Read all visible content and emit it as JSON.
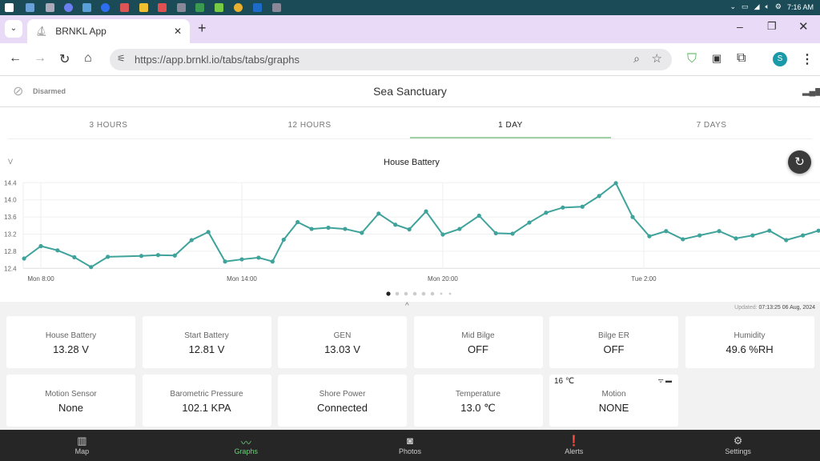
{
  "taskbar": {
    "time": "7:16 AM"
  },
  "browser": {
    "tab_title": "BRNKL App",
    "url": "https://app.brnkl.io/tabs/tabs/graphs",
    "profile_initial": "S"
  },
  "header": {
    "status": "Disarmed",
    "title": "Sea Sanctuary"
  },
  "ranges": [
    {
      "label": "3 HOURS",
      "active": false
    },
    {
      "label": "12 HOURS",
      "active": false
    },
    {
      "label": "1 DAY",
      "active": true
    },
    {
      "label": "7 DAYS",
      "active": false
    }
  ],
  "chart_data": {
    "type": "line",
    "title": "House Battery",
    "ylabel": "V",
    "ylim": [
      12.4,
      14.4
    ],
    "yticks": [
      "12.4",
      "12.8",
      "13.2",
      "13.6",
      "14.0",
      "14.4"
    ],
    "xticks": [
      "Mon 8:00",
      "Mon 14:00",
      "Mon 20:00",
      "Tue 2:00"
    ],
    "grid": true,
    "color": "#3fa39b",
    "x": [
      "Mon 7:30",
      "Mon 8:00",
      "Mon 8:30",
      "Mon 9:00",
      "Mon 9:30",
      "Mon 10:00",
      "Mon 11:00",
      "Mon 11:30",
      "Mon 12:00",
      "Mon 12:30",
      "Mon 13:00",
      "Mon 13:30",
      "Mon 14:00",
      "Mon 14:30",
      "Mon 14:55",
      "Mon 15:15",
      "Mon 15:40",
      "Mon 16:05",
      "Mon 16:35",
      "Mon 17:05",
      "Mon 17:35",
      "Mon 18:05",
      "Mon 18:35",
      "Mon 19:00",
      "Mon 19:30",
      "Mon 20:00",
      "Mon 20:30",
      "Mon 21:05",
      "Mon 21:35",
      "Mon 22:05",
      "Mon 22:35",
      "Mon 23:05",
      "Mon 23:35",
      "Tue 0:10",
      "Tue 0:40",
      "Tue 1:10",
      "Tue 1:40",
      "Tue 2:10",
      "Tue 2:40",
      "Tue 3:10",
      "Tue 3:40",
      "Tue 4:15",
      "Tue 4:45",
      "Tue 5:15",
      "Tue 5:45",
      "Tue 6:15",
      "Tue 6:45",
      "Tue 7:13"
    ],
    "values": [
      12.63,
      12.92,
      12.82,
      12.66,
      12.43,
      12.67,
      12.69,
      12.71,
      12.7,
      13.06,
      13.25,
      12.56,
      12.61,
      12.65,
      12.56,
      13.07,
      13.48,
      13.32,
      13.35,
      13.32,
      13.23,
      13.68,
      13.42,
      13.31,
      13.73,
      13.19,
      13.32,
      13.63,
      13.22,
      13.21,
      13.47,
      13.7,
      13.82,
      13.84,
      14.09,
      14.39,
      13.6,
      13.15,
      13.27,
      13.08,
      13.17,
      13.27,
      13.1,
      13.17,
      13.28,
      13.06,
      13.17,
      13.28
    ]
  },
  "pager": {
    "count": 8,
    "active": 0
  },
  "updated": {
    "label": "Updated:",
    "value": "07:13:25 06 Aug, 2024"
  },
  "cards": [
    {
      "label": "House Battery",
      "value": "13.28 V"
    },
    {
      "label": "Start Battery",
      "value": "12.81 V"
    },
    {
      "label": "GEN",
      "value": "13.03 V"
    },
    {
      "label": "Mid Bilge",
      "value": "OFF"
    },
    {
      "label": "Bilge ER",
      "value": "OFF"
    },
    {
      "label": "Humidity",
      "value": "49.6 %RH"
    },
    {
      "label": "Motion Sensor",
      "value": "None"
    },
    {
      "label": "Barometric Pressure",
      "value": "102.1 KPA"
    },
    {
      "label": "Shore Power",
      "value": "Connected"
    },
    {
      "label": "Temperature",
      "value": "13.0 ℃"
    },
    {
      "label": "Motion",
      "value": "NONE",
      "corner": "16 ℃"
    }
  ],
  "bottom_nav": [
    {
      "label": "Map",
      "icon": "map-icon"
    },
    {
      "label": "Graphs",
      "icon": "graph-icon",
      "active": true
    },
    {
      "label": "Photos",
      "icon": "camera-icon"
    },
    {
      "label": "Alerts",
      "icon": "alert-icon"
    },
    {
      "label": "Settings",
      "icon": "gear-icon"
    }
  ]
}
